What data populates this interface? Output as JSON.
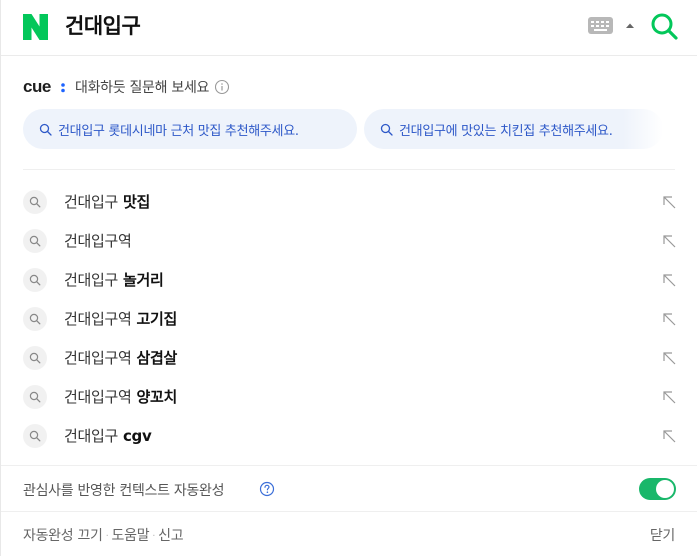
{
  "search": {
    "query": "건대입구",
    "logo_icon": "naver-n-icon",
    "keyboard_icon": "keyboard-icon",
    "collapse_icon": "caret-up-icon",
    "submit_icon": "search-icon",
    "brand_color": "#03c75a"
  },
  "cue": {
    "logo_text": "cue:",
    "prompt": "대화하듯 질문해 보세요",
    "info_icon": "info-icon",
    "chips": [
      {
        "label": "건대입구 롯데시네마 근처 맛집 추천해주세요."
      },
      {
        "label": "건대입구에 맛있는 치킨집 추천해주세요."
      }
    ],
    "chip_text_color": "#2d58c8"
  },
  "suggestions": [
    {
      "prefix": "건대입구",
      "suffix": " 맛집"
    },
    {
      "prefix": "건대입구역",
      "suffix": ""
    },
    {
      "prefix": "건대입구",
      "suffix": " 놀거리"
    },
    {
      "prefix": "건대입구역",
      "suffix": " 고기집"
    },
    {
      "prefix": "건대입구역",
      "suffix": " 삼겹살"
    },
    {
      "prefix": "건대입구역",
      "suffix": " 양꼬치"
    },
    {
      "prefix": "건대입구",
      "suffix": " cgv"
    }
  ],
  "preferences": {
    "context_label": "관심사를 반영한 컨텍스트 자동완성",
    "help_icon": "help-icon",
    "toggle_on": true,
    "toggle_color": "#19b76a"
  },
  "footer": {
    "autocomplete_off": "자동완성 끄기",
    "help": "도움말",
    "report": "신고",
    "close": "닫기"
  }
}
